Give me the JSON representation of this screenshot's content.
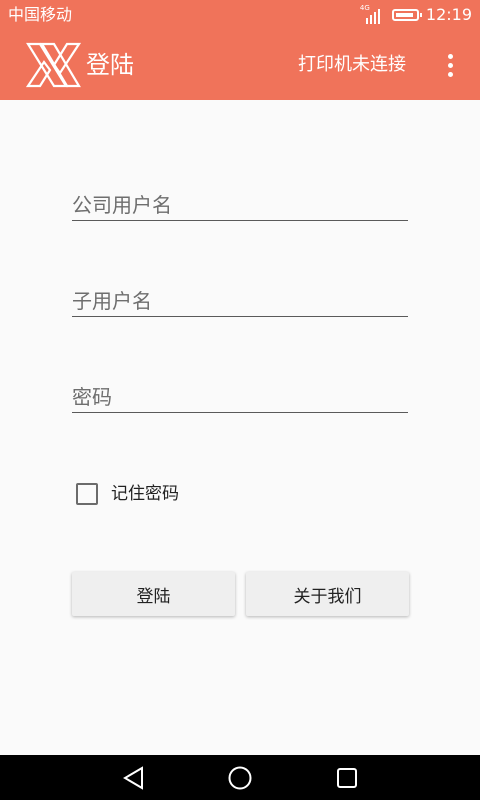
{
  "status_bar": {
    "carrier": "中国移动",
    "network_type": "4G",
    "time": "12:19"
  },
  "app_bar": {
    "title": "登陆",
    "printer_status": "打印机未连接",
    "logo_icon": "x-logo-icon",
    "menu_icon": "more-vert-icon",
    "color": "#f0735a"
  },
  "form": {
    "company_username": {
      "placeholder": "公司用户名",
      "value": ""
    },
    "sub_username": {
      "placeholder": "子用户名",
      "value": ""
    },
    "password": {
      "placeholder": "密码",
      "value": ""
    },
    "remember_password": {
      "label": "记住密码",
      "checked": false
    }
  },
  "buttons": {
    "login": "登陆",
    "about": "关于我们"
  },
  "nav_bar": {
    "icons": [
      "back-icon",
      "home-icon",
      "recent-apps-icon"
    ]
  }
}
